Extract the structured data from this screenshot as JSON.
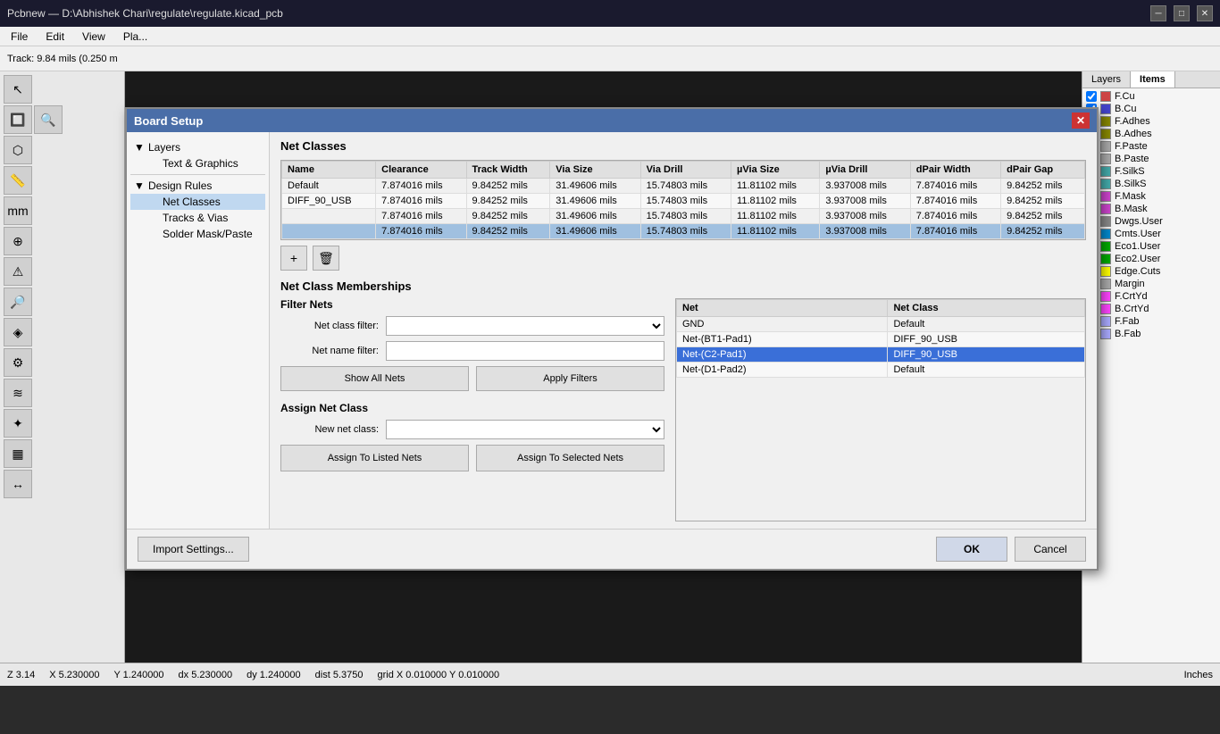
{
  "app": {
    "title": "Pcbnew — D:\\Abhishek Chari\\regulate\\regulate.kicad_pcb",
    "menu": [
      "File",
      "Edit",
      "View",
      "Pla..."
    ]
  },
  "track_bar": {
    "track_info": "Track: 9.84 mils (0.250 m"
  },
  "dialog": {
    "title": "Board Setup",
    "close_label": "✕"
  },
  "tree": {
    "items": [
      {
        "id": "layers",
        "label": "Layers",
        "level": 0,
        "expanded": true
      },
      {
        "id": "text_graphics",
        "label": "Text & Graphics",
        "level": 1
      },
      {
        "id": "design_rules",
        "label": "Design Rules",
        "level": 0,
        "expanded": true
      },
      {
        "id": "net_classes",
        "label": "Net Classes",
        "level": 1,
        "selected": true
      },
      {
        "id": "tracks_vias",
        "label": "Tracks & Vias",
        "level": 1
      },
      {
        "id": "solder_mask_paste",
        "label": "Solder Mask/Paste",
        "level": 1
      }
    ]
  },
  "section_title": "Net Classes",
  "table": {
    "columns": [
      "Name",
      "Clearance",
      "Track Width",
      "Via Size",
      "Via Drill",
      "µVia Size",
      "µVia Drill",
      "dPair Width",
      "dPair Gap"
    ],
    "rows": [
      {
        "name": "Default",
        "clearance": "7.874016 mils",
        "track_width": "9.84252 mils",
        "via_size": "31.49606 mils",
        "via_drill": "15.74803 mils",
        "uvia_size": "11.81102 mils",
        "uvia_drill": "3.937008 mils",
        "dpair_width": "7.874016 mils",
        "dpair_gap": "9.84252 mils",
        "selected": false
      },
      {
        "name": "DIFF_90_USB",
        "clearance": "7.874016 mils",
        "track_width": "9.84252 mils",
        "via_size": "31.49606 mils",
        "via_drill": "15.74803 mils",
        "uvia_size": "11.81102 mils",
        "uvia_drill": "3.937008 mils",
        "dpair_width": "7.874016 mils",
        "dpair_gap": "9.84252 mils",
        "selected": false
      },
      {
        "name": "",
        "clearance": "7.874016 mils",
        "track_width": "9.84252 mils",
        "via_size": "31.49606 mils",
        "via_drill": "15.74803 mils",
        "uvia_size": "11.81102 mils",
        "uvia_drill": "3.937008 mils",
        "dpair_width": "7.874016 mils",
        "dpair_gap": "9.84252 mils",
        "selected": false
      },
      {
        "name": "",
        "clearance": "7.874016 mils",
        "track_width": "9.84252 mils",
        "via_size": "31.49606 mils",
        "via_drill": "15.74803 mils",
        "uvia_size": "11.81102 mils",
        "uvia_drill": "3.937008 mils",
        "dpair_width": "7.874016 mils",
        "dpair_gap": "9.84252 mils",
        "selected": true
      }
    ]
  },
  "table_actions": {
    "add_label": "+",
    "delete_label": "🗑"
  },
  "memberships": {
    "title": "Net Class Memberships",
    "filter_nets_title": "Filter Nets",
    "net_class_filter_label": "Net class filter:",
    "net_name_filter_label": "Net name filter:",
    "show_all_nets_label": "Show All Nets",
    "apply_filters_label": "Apply Filters",
    "assign_net_class_title": "Assign Net Class",
    "new_net_class_label": "New net class:",
    "assign_to_listed_label": "Assign To Listed Nets",
    "assign_to_selected_label": "Assign To Selected Nets"
  },
  "net_table": {
    "columns": [
      "Net",
      "Net Class"
    ],
    "rows": [
      {
        "net": "GND",
        "net_class": "Default",
        "selected": false
      },
      {
        "net": "Net-(BT1-Pad1)",
        "net_class": "DIFF_90_USB",
        "selected": false
      },
      {
        "net": "Net-(C2-Pad1)",
        "net_class": "DIFF_90_USB",
        "selected": true
      },
      {
        "net": "Net-(D1-Pad2)",
        "net_class": "Default",
        "selected": false
      }
    ]
  },
  "footer": {
    "import_label": "Import Settings...",
    "ok_label": "OK",
    "cancel_label": "Cancel"
  },
  "right_panel": {
    "tabs": [
      "Layers",
      "Items"
    ],
    "active_tab": "Items",
    "layers": [
      {
        "name": "F.Cu",
        "color": "#cc4444",
        "checked": true
      },
      {
        "name": "B.Cu",
        "color": "#4444cc",
        "checked": true
      },
      {
        "name": "F.Adhes",
        "color": "#888800",
        "checked": true
      },
      {
        "name": "B.Adhes",
        "color": "#888800",
        "checked": true
      },
      {
        "name": "F.Paste",
        "color": "#aaaaaa",
        "checked": true
      },
      {
        "name": "B.Paste",
        "color": "#aaaaaa",
        "checked": true
      },
      {
        "name": "F.SilkS",
        "color": "#44aaaa",
        "checked": true
      },
      {
        "name": "B.SilkS",
        "color": "#44aaaa",
        "checked": true
      },
      {
        "name": "F.Mask",
        "color": "#cc44cc",
        "checked": true
      },
      {
        "name": "B.Mask",
        "color": "#cc44cc",
        "checked": true
      },
      {
        "name": "Dwgs.User",
        "color": "#888888",
        "checked": true
      },
      {
        "name": "Cmts.User",
        "color": "#0088cc",
        "checked": true
      },
      {
        "name": "Eco1.User",
        "color": "#00aa00",
        "checked": true
      },
      {
        "name": "Eco2.User",
        "color": "#00aa00",
        "checked": true
      },
      {
        "name": "Edge.Cuts",
        "color": "#ffff00",
        "checked": true
      },
      {
        "name": "Margin",
        "color": "#aaaaaa",
        "checked": true
      },
      {
        "name": "F.CrtYd",
        "color": "#ff44ff",
        "checked": true
      },
      {
        "name": "B.CrtYd",
        "color": "#ff44ff",
        "checked": true
      },
      {
        "name": "F.Fab",
        "color": "#aaaaff",
        "checked": true
      },
      {
        "name": "B.Fab",
        "color": "#aaaaff",
        "checked": true
      }
    ]
  },
  "status_bar": {
    "z": "Z 3.14",
    "x": "X 5.230000",
    "y": "Y 1.240000",
    "dx": "dx 5.230000",
    "dy": "dy 1.240000",
    "dist": "dist 5.3750",
    "grid": "grid X 0.010000  Y 0.010000",
    "units": "Inches"
  }
}
